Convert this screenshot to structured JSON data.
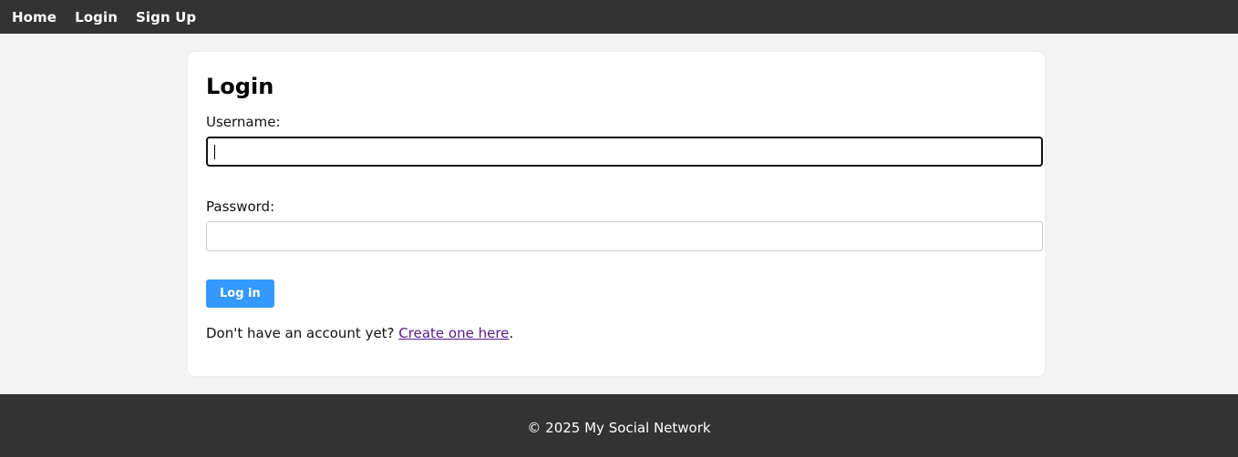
{
  "nav": {
    "items": [
      {
        "label": "Home"
      },
      {
        "label": "Login"
      },
      {
        "label": "Sign Up"
      }
    ]
  },
  "login": {
    "title": "Login",
    "username_label": "Username:",
    "username_value": "",
    "password_label": "Password:",
    "password_value": "",
    "submit_label": "Log in",
    "signup_prompt": "Don't have an account yet? ",
    "signup_link": "Create one here",
    "signup_suffix": "."
  },
  "footer": {
    "text": "© 2025 My Social Network"
  },
  "colors": {
    "nav_bg": "#333333",
    "button_bg": "#3399ff",
    "link_visited": "#551a8b",
    "page_bg": "#f3f3f3"
  }
}
